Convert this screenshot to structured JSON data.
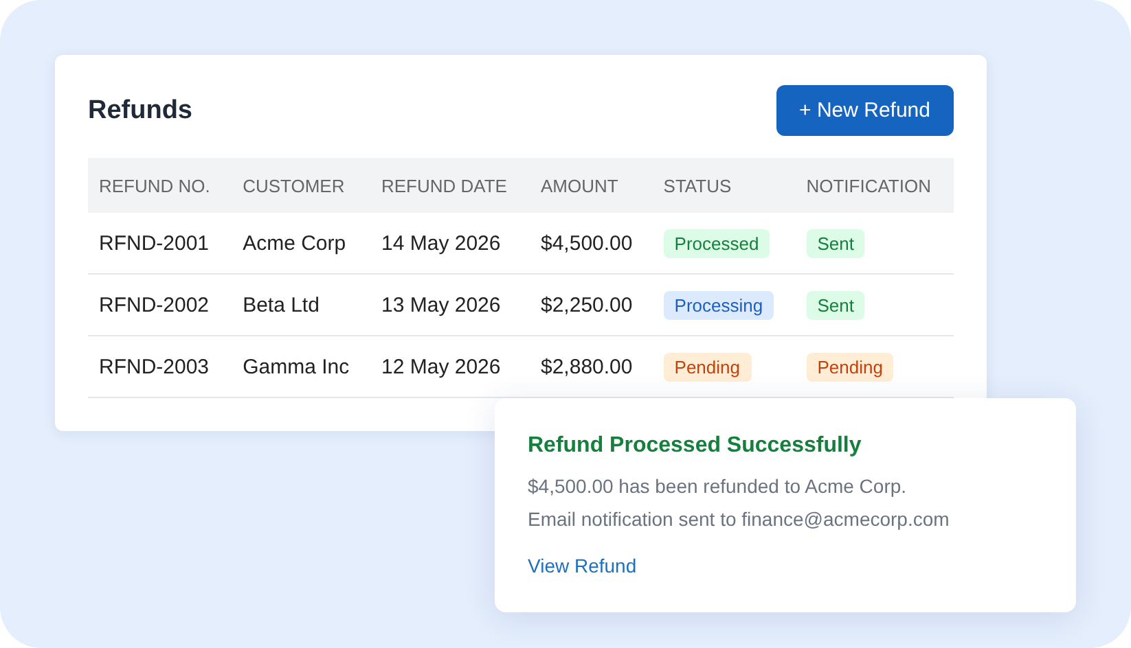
{
  "panel": {
    "title": "Refunds",
    "new_button": "+ New Refund"
  },
  "table": {
    "columns": [
      "REFUND NO.",
      "CUSTOMER",
      "REFUND DATE",
      "AMOUNT",
      "STATUS",
      "NOTIFICATION"
    ],
    "rows": [
      {
        "number": "RFND-2001",
        "customer": "Acme Corp",
        "date": "14 May 2026",
        "amount": "$4,500.00",
        "status": {
          "label": "Processed",
          "kind": "success"
        },
        "notification": {
          "label": "Sent",
          "kind": "success"
        }
      },
      {
        "number": "RFND-2002",
        "customer": "Beta Ltd",
        "date": "13 May 2026",
        "amount": "$2,250.00",
        "status": {
          "label": "Processing",
          "kind": "info"
        },
        "notification": {
          "label": "Sent",
          "kind": "success"
        }
      },
      {
        "number": "RFND-2003",
        "customer": "Gamma Inc",
        "date": "12 May 2026",
        "amount": "$2,880.00",
        "status": {
          "label": "Pending",
          "kind": "warning"
        },
        "notification": {
          "label": "Pending",
          "kind": "warning"
        }
      }
    ]
  },
  "toast": {
    "title": "Refund Processed Successfully",
    "lines": [
      "$4,500.00 has been refunded to Acme Corp.",
      "Email notification sent to finance@acmecorp.com"
    ],
    "link": "View Refund"
  }
}
